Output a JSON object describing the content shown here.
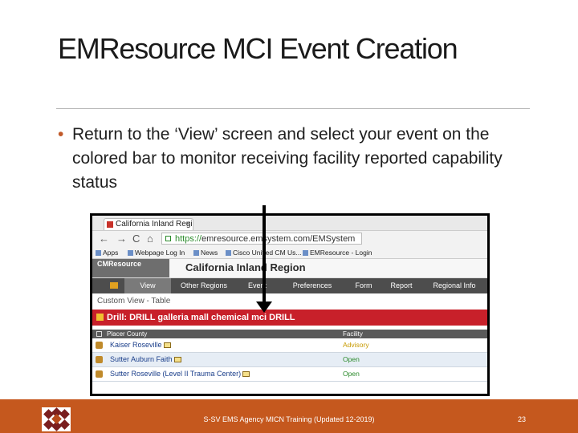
{
  "slide": {
    "title": "EMResource MCI Event Creation",
    "bullet": "Return to the ‘View’ screen and select your event on the colored bar to monitor receiving facility reported capability status",
    "footer_text": "S-SV EMS Agency MICN Training (Updated 12-2019)",
    "page_number": "23"
  },
  "screenshot": {
    "tab_title": "California Inland Region",
    "url_https": "https://",
    "url_rest": "emresource.emsystem.com/EMSystem",
    "bookmarks": [
      "Apps",
      "Webpage Log In",
      "News",
      "Cisco Unified CM Us...",
      "EMResource - Login"
    ],
    "brand": "CMResource",
    "region_title": "California Inland Region",
    "nav": [
      "View",
      "Other Regions",
      "Event",
      "Preferences",
      "Form",
      "Report",
      "Regional Info"
    ],
    "custom_view": "Custom View - Table",
    "event_bar": "Drill: DRILL galleria mall chemical mci DRILL",
    "table": {
      "col_county": "Placer County",
      "col_facility": "Facility",
      "rows": [
        {
          "name": "Kaiser Roseville",
          "status": "Advisory"
        },
        {
          "name": "Sutter Auburn Faith",
          "status": "Open"
        },
        {
          "name": "Sutter Roseville (Level II Trauma Center)",
          "status": "Open"
        }
      ]
    }
  },
  "colors": {
    "accent_orange": "#c5581e",
    "event_bar_red": "#c8202a",
    "nav_gray": "#4d4d4d"
  }
}
